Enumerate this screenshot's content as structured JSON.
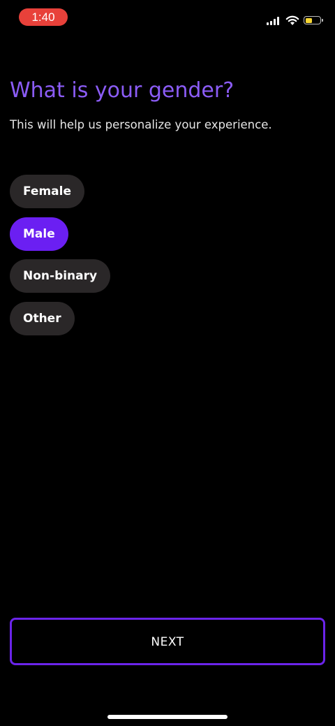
{
  "status_bar": {
    "time": "1:40",
    "time_pill_color": "#e8413a",
    "battery_color": "#f7d633",
    "icons": [
      "signal-icon",
      "wifi-icon",
      "battery-icon"
    ]
  },
  "header": {
    "title": "What is your gender?",
    "subtitle": "This will help us personalize your experience."
  },
  "options": [
    {
      "label": "Female",
      "selected": false
    },
    {
      "label": "Male",
      "selected": true
    },
    {
      "label": "Non-binary",
      "selected": false
    },
    {
      "label": "Other",
      "selected": false
    }
  ],
  "footer": {
    "next_label": "NEXT"
  },
  "colors": {
    "accent": "#6b1ff2",
    "title": "#8b5cf6",
    "chip_background": "#2a2728",
    "background": "#000000"
  }
}
